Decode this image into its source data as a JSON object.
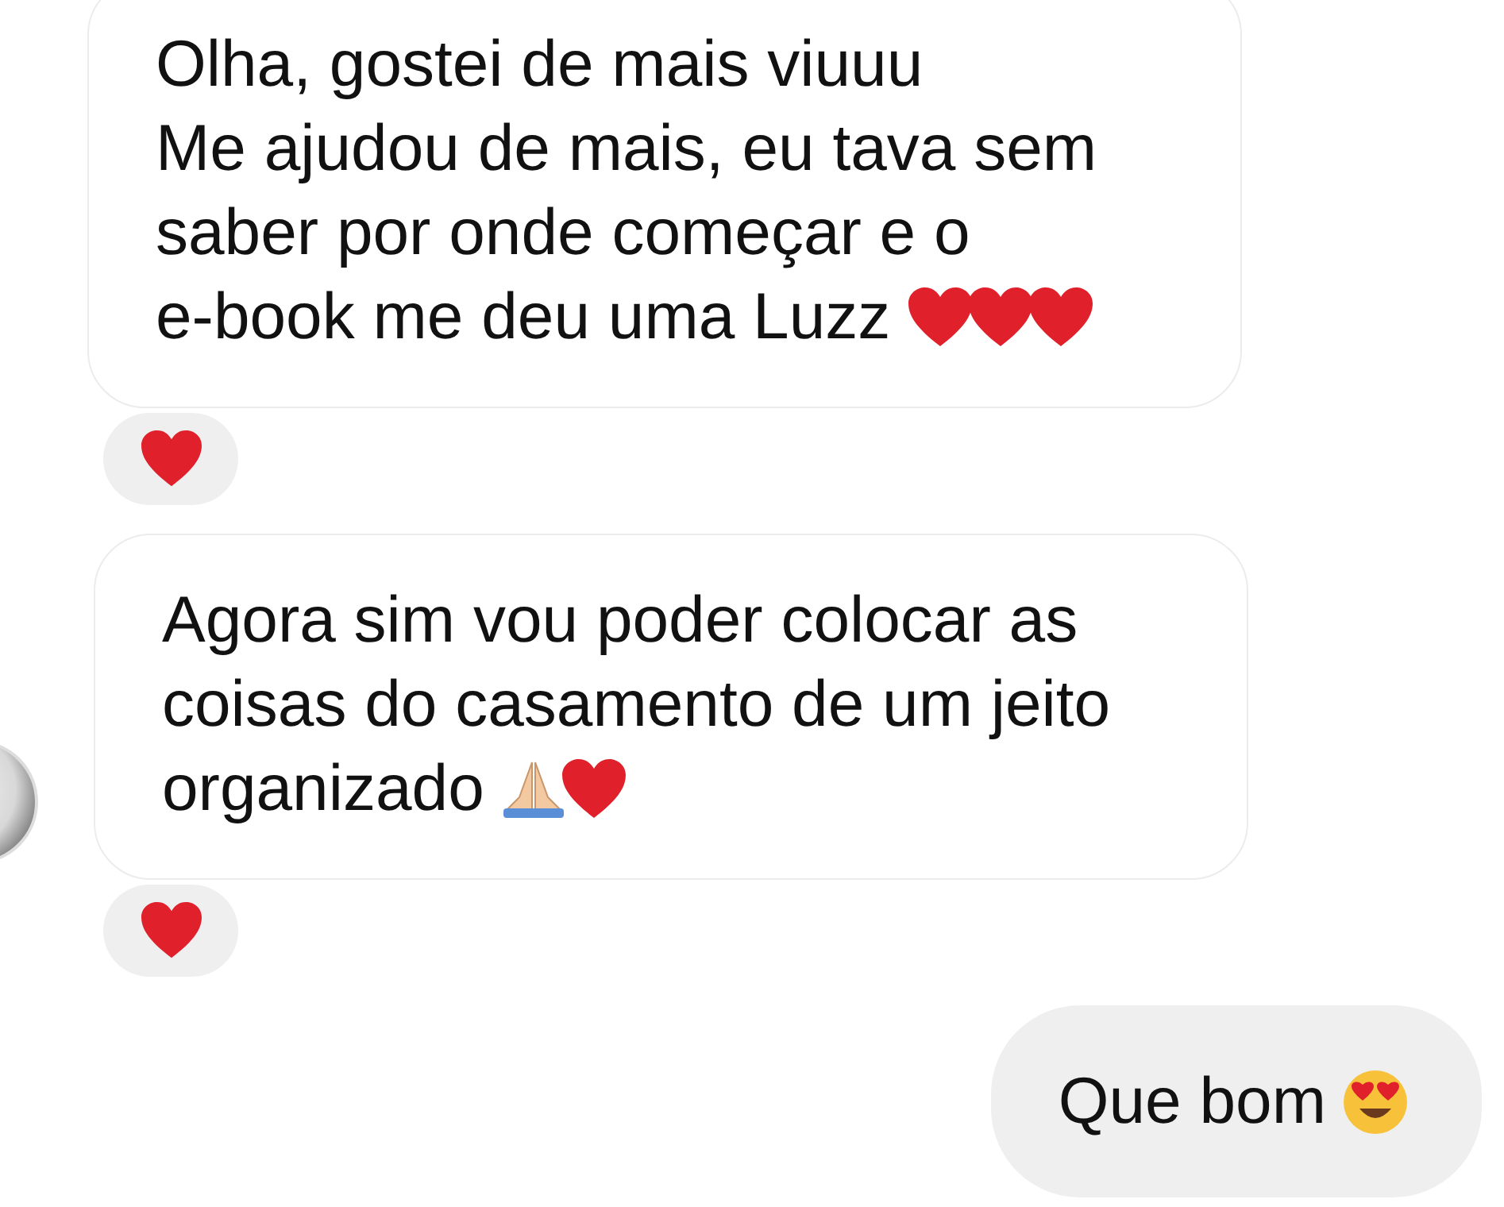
{
  "messages": [
    {
      "kind": "received",
      "avatar": false,
      "lines": [
        "Olha, gostei de mais viuuu",
        "Me ajudou de mais, eu tava sem",
        "saber por onde começar e o",
        "e-book me deu uma Luzz"
      ],
      "emoji": [
        {
          "kind": "heart"
        },
        {
          "kind": "heart"
        },
        {
          "kind": "heart"
        }
      ],
      "reaction": {
        "kind": "heart"
      }
    },
    {
      "kind": "received",
      "avatar": true,
      "lines": [
        "Agora sim vou poder colocar as",
        "coisas do casamento de um jeito",
        "organizado"
      ],
      "emoji": [
        {
          "kind": "pray"
        },
        {
          "kind": "heart"
        }
      ],
      "reaction": {
        "kind": "heart"
      }
    },
    {
      "kind": "sent",
      "avatar": false,
      "lines": [
        "Que bom"
      ],
      "emoji": [
        {
          "kind": "hearteyes"
        }
      ]
    }
  ]
}
